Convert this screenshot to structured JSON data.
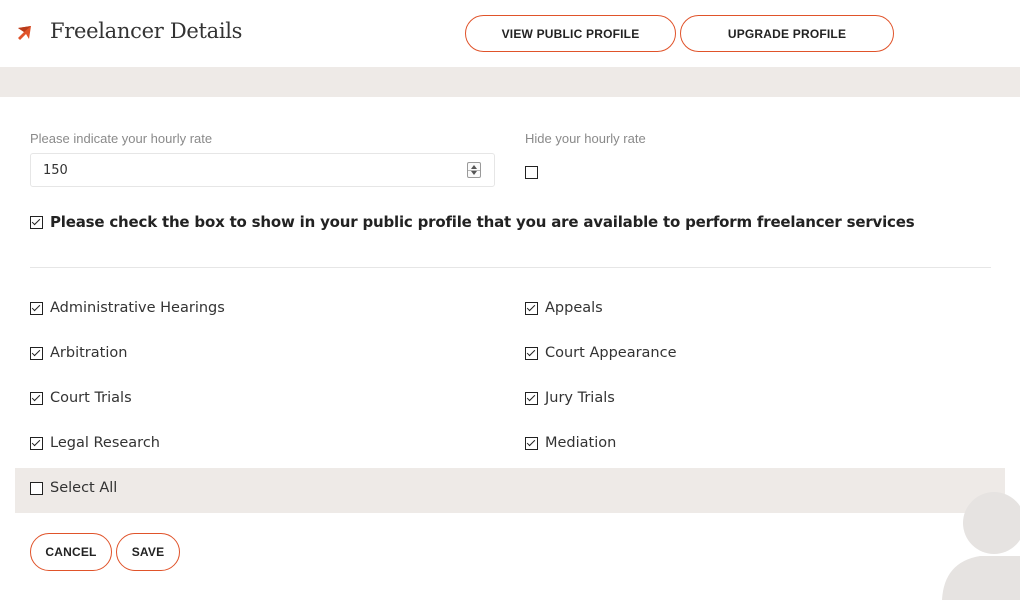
{
  "header": {
    "title": "Freelancer Details",
    "view_profile_label": "VIEW PUBLIC PROFILE",
    "upgrade_profile_label": "UPGRADE PROFILE"
  },
  "rate": {
    "label": "Please indicate your hourly rate",
    "value": "150",
    "hide_label": "Hide your hourly rate",
    "hide_checked": false
  },
  "availability": {
    "label": "Please check the box to show in your public profile that you are available to perform freelancer services",
    "checked": true
  },
  "services": [
    {
      "label": "Administrative Hearings",
      "checked": true
    },
    {
      "label": "Appeals",
      "checked": true
    },
    {
      "label": "Arbitration",
      "checked": true
    },
    {
      "label": "Court Appearance",
      "checked": true
    },
    {
      "label": "Court Trials",
      "checked": true
    },
    {
      "label": "Jury Trials",
      "checked": true
    },
    {
      "label": "Legal Research",
      "checked": true
    },
    {
      "label": "Mediation",
      "checked": true
    }
  ],
  "select_all": {
    "label": "Select All",
    "checked": false
  },
  "actions": {
    "cancel_label": "CANCEL",
    "save_label": "SAVE"
  },
  "colors": {
    "accent": "#e0532a",
    "band": "#eeeae7",
    "avatar": "#e6e3e1"
  },
  "icons": {
    "logo": "arrow-logo-icon",
    "avatar": "user-avatar-icon"
  }
}
